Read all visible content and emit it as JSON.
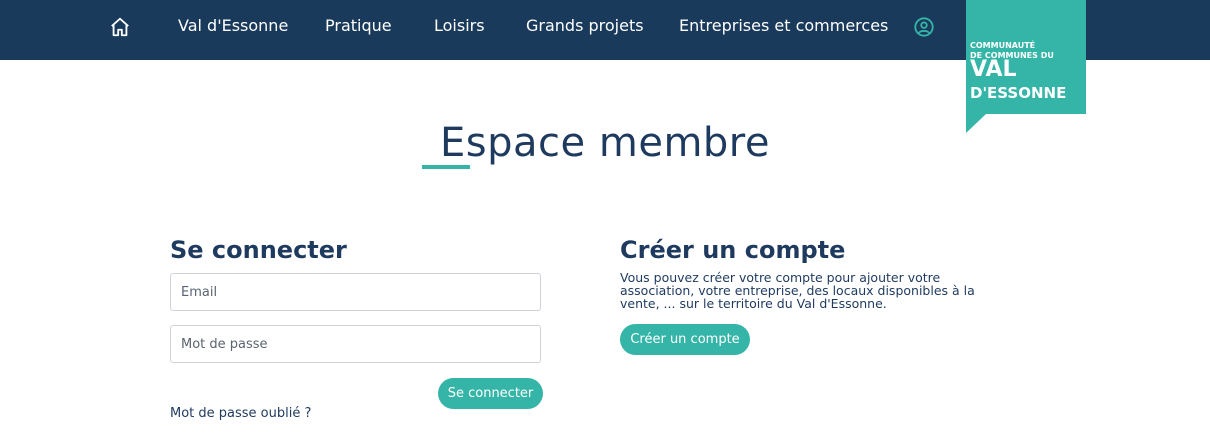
{
  "nav": {
    "items": [
      "Val d'Essonne",
      "Pratique",
      "Loisirs",
      "Grands projets",
      "Entreprises et commerces"
    ],
    "home_icon": "home-icon",
    "account_icon": "user-circle-icon"
  },
  "logo": {
    "line1": "COMMUNAUTÉ",
    "line2": "DE COMMUNES DU",
    "line3": "VAL",
    "line4": "D'ESSONNE"
  },
  "page": {
    "title": "Espace membre"
  },
  "login": {
    "title": "Se connecter",
    "email_placeholder": "Email",
    "password_placeholder": "Mot de passe",
    "submit_label": "Se connecter",
    "forgot_label": "Mot de passe oublié ?"
  },
  "signup": {
    "title": "Créer un compte",
    "description": "Vous pouvez créer votre compte pour ajouter votre association, votre entreprise, des locaux disponibles à la vente, ... sur le territoire du Val d'Essonne.",
    "button_label": "Créer un compte"
  },
  "colors": {
    "nav_bg": "#1a3a5c",
    "accent": "#35b5a8",
    "text": "#1e3a5f"
  }
}
